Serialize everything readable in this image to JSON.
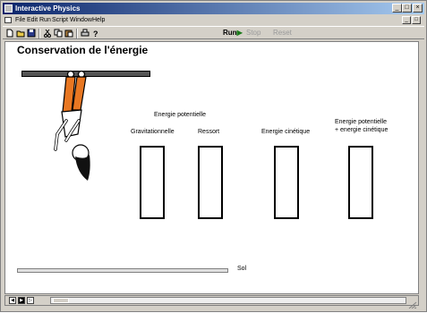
{
  "window": {
    "title": "Interactive Physics",
    "minimize_glyph": "_",
    "maximize_glyph": "□",
    "close_glyph": "×",
    "mdi_minimize_glyph": "_",
    "mdi_restore_glyph": "□"
  },
  "menu": {
    "items": [
      "File",
      "Edit",
      "Run",
      "Script",
      "Window",
      "Help"
    ]
  },
  "toolbar": {
    "icons": [
      "new-file-icon",
      "open-folder-icon",
      "save-icon",
      "cut-icon",
      "copy-icon",
      "paste-icon",
      "print-icon",
      "help-icon"
    ],
    "run_label": "Run",
    "run_arrow": "▶",
    "stop_label": "Stop",
    "reset_label": "Reset"
  },
  "scene": {
    "title": "Conservation de l'énergie",
    "group_label": "Energie potentielle",
    "columns": [
      "Gravitationnelle",
      "Ressort",
      "Energie cinétique",
      "Energie potentielle",
      "+ energie cinétique"
    ],
    "slider_label": "Sol"
  },
  "playback": {
    "controls": [
      "step-back",
      "play",
      "step-forward"
    ]
  }
}
